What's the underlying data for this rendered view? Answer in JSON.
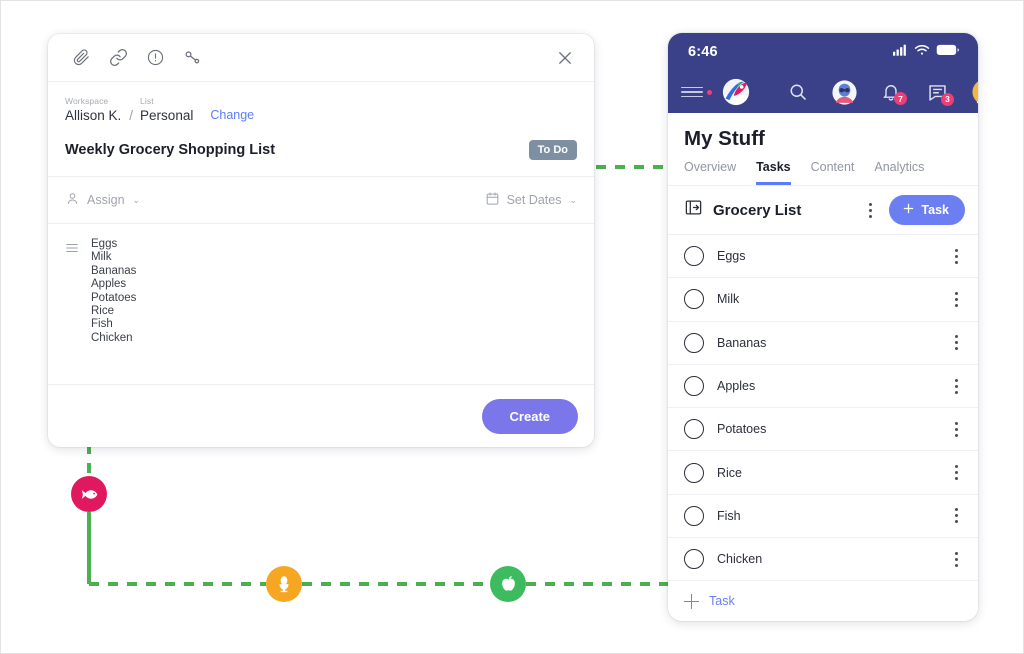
{
  "task_card": {
    "toolbar_icons": [
      "paperclip-icon",
      "link-icon",
      "priority-icon",
      "subtask-icon"
    ],
    "close_icon": "close-icon",
    "breadcrumb": {
      "workspace_label": "Workspace",
      "workspace_value": "Allison K.",
      "separator": "/",
      "list_label": "List",
      "list_value": "Personal",
      "change_link": "Change"
    },
    "title": "Weekly Grocery Shopping List",
    "status": "To Do",
    "assign": {
      "label": "Assign",
      "icon": "person-icon",
      "caret": "⌄"
    },
    "dates": {
      "label": "Set Dates",
      "icon": "calendar-icon",
      "caret": "⌄"
    },
    "description_icon": "list-lines-icon",
    "description_items": [
      "Eggs",
      "Milk",
      "Bananas",
      "Apples",
      "Potatoes",
      "Rice",
      "Fish",
      "Chicken"
    ],
    "create_button": "Create"
  },
  "graph_nodes": [
    {
      "name": "fish-node",
      "icon": "fish-icon",
      "color": "#e0195f"
    },
    {
      "name": "egg-node",
      "icon": "egg-icon",
      "color": "#f5a623"
    },
    {
      "name": "apple-node",
      "icon": "apple-icon",
      "color": "#3dbb5e"
    }
  ],
  "connector_color": "#4caf50",
  "phone": {
    "status_bar": {
      "time": "6:46",
      "icons": [
        "signal-icon",
        "wifi-icon",
        "battery-icon"
      ]
    },
    "app_bar": {
      "menu_icon": "hamburger-icon",
      "logo_icon": "rocket-logo-icon",
      "search_icon": "search-icon",
      "avatar_icon": "user-avatar-icon",
      "notifications_icon": "bell-icon",
      "notifications_count": "7",
      "messages_icon": "chat-icon",
      "messages_count": "3",
      "profile_icon": "profile-avatar-icon"
    },
    "page_title": "My Stuff",
    "tabs": [
      {
        "label": "Overview",
        "active": false
      },
      {
        "label": "Tasks",
        "active": true
      },
      {
        "label": "Content",
        "active": false
      },
      {
        "label": "Analytics",
        "active": false
      }
    ],
    "list_header": {
      "icon": "open-list-icon",
      "title": "Grocery List",
      "kebab_icon": "kebab-menu-icon",
      "add_button": "Task",
      "add_button_icon": "plus-icon"
    },
    "tasks": [
      {
        "label": "Eggs"
      },
      {
        "label": "Milk"
      },
      {
        "label": "Bananas"
      },
      {
        "label": "Apples"
      },
      {
        "label": "Potatoes"
      },
      {
        "label": "Rice"
      },
      {
        "label": "Fish"
      },
      {
        "label": "Chicken"
      }
    ],
    "add_task_link": "Task"
  }
}
